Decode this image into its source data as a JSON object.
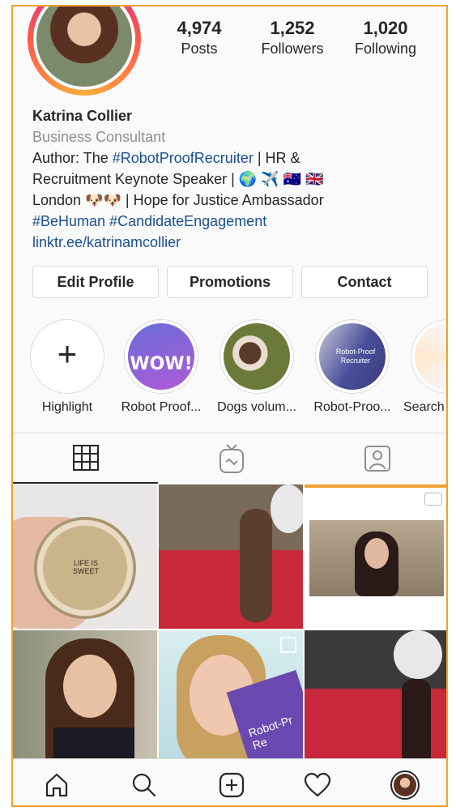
{
  "profile": {
    "name": "Katrina Collier",
    "category": "Business Consultant",
    "bio_line1_prefix": "Author: The ",
    "bio_line1_tag": "#RobotProofRecruiter",
    "bio_line1_suffix": " | HR &",
    "bio_line2": "Recruitment Keynote Speaker | 🌍 ✈️ 🇦🇺 🇬🇧",
    "bio_line3": "London 🐶🐶 | Hope for Justice Ambassador",
    "bio_tags": "#BeHuman #CandidateEngagement",
    "website": "linktr.ee/katrinamcollier"
  },
  "stats": [
    {
      "value": "4,974",
      "label": "Posts"
    },
    {
      "value": "1,252",
      "label": "Followers"
    },
    {
      "value": "1,020",
      "label": "Following"
    }
  ],
  "buttons": {
    "edit": "Edit Profile",
    "promotions": "Promotions",
    "contact": "Contact"
  },
  "highlights": [
    {
      "label": "Highlight"
    },
    {
      "label": "Robot Proof...",
      "text": "WOW!"
    },
    {
      "label": "Dogs volum..."
    },
    {
      "label": "Robot-Proo...",
      "text": "Robot-Proof Recruiter"
    },
    {
      "label": "Search"
    }
  ],
  "grid_texts": {
    "lid": "LIFE IS SWEET",
    "book": "Robot-Pr Re"
  },
  "colors": {
    "accent_frame": "#f0a030",
    "link": "#1b4f8f",
    "border": "#dbdbdb"
  }
}
